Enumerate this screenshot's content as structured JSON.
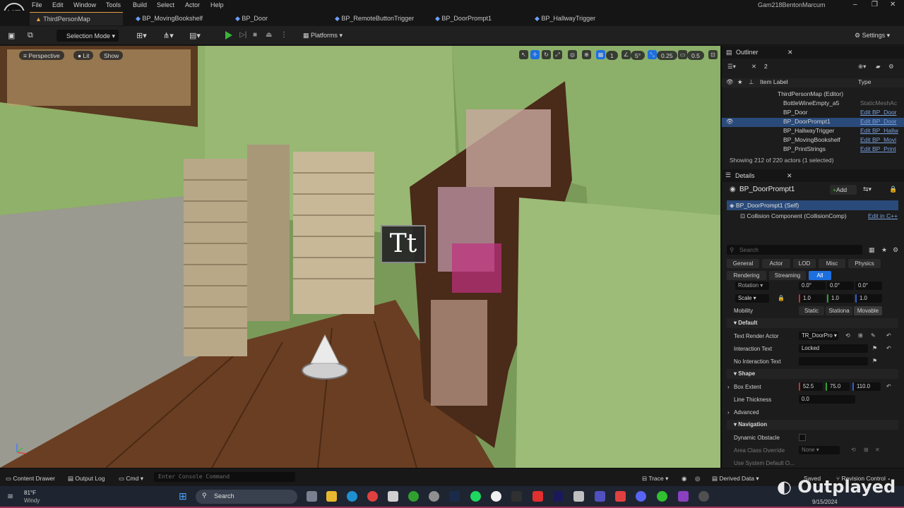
{
  "menubar": {
    "items": [
      "File",
      "Edit",
      "Window",
      "Tools",
      "Build",
      "Select",
      "Actor",
      "Help"
    ],
    "user": "Gam218BentonMarcum",
    "logo": "UE"
  },
  "tabs": [
    "ThirdPersonMap",
    "BP_MovingBookshelf",
    "BP_Door",
    "BP_RemoteButtonTrigger",
    "BP_DoorPrompt1",
    "BP_HallwayTrigger"
  ],
  "toolbar": {
    "selection_mode": "Selection Mode",
    "platforms": "Platforms",
    "settings": "Settings"
  },
  "viewport": {
    "perspective": "Perspective",
    "lit": "Lit",
    "show": "Show",
    "grid_size": "1",
    "angle": "5°",
    "scale_snap": "0.25",
    "camera_speed": "0.5",
    "text_render_glyph": "Tt"
  },
  "outliner": {
    "title": "Outliner",
    "search_value": "2",
    "col_label": "Item Label",
    "col_type": "Type",
    "items": [
      {
        "label": "ThirdPersonMap (Editor)",
        "type": ""
      },
      {
        "label": "BottleWineEmpty_a5",
        "type": "StaticMeshAc"
      },
      {
        "label": "BP_Door",
        "type": "Edit BP_Door"
      },
      {
        "label": "BP_DoorPrompt1",
        "type": "Edit BP_Door"
      },
      {
        "label": "BP_HallwayTrigger",
        "type": "Edit BP_Hallw"
      },
      {
        "label": "BP_MovingBookshelf",
        "type": "Edit BP_Movi"
      },
      {
        "label": "BP_PrintStrings",
        "type": "Edit BP_Print"
      }
    ],
    "status": "Showing 212 of 220 actors (1 selected)"
  },
  "details": {
    "title": "Details",
    "actor_name": "BP_DoorPrompt1",
    "add_label": "Add",
    "self_label": "BP_DoorPrompt1 (Self)",
    "component_label": "Collision Component (CollisionComp)",
    "edit_cpp": "Edit in C++",
    "search_placeholder": "Search",
    "categories": [
      "General",
      "Actor",
      "LOD",
      "Misc",
      "Physics",
      "Rendering",
      "Streaming",
      "All"
    ],
    "rotation_label": "Rotation",
    "rotation_values": [
      "0.0°",
      "0.0°",
      "0.0°"
    ],
    "scale_label": "Scale",
    "scale_values": [
      "1.0",
      "1.0",
      "1.0"
    ],
    "mobility_label": "Mobility",
    "mobility_options": [
      "Static",
      "Stationa",
      "Movable"
    ],
    "section_default": "Default",
    "text_render_actor_label": "Text Render Actor",
    "text_render_actor_value": "TR_DoorPro",
    "interaction_text_label": "Interaction Text",
    "interaction_text_value": "Locked",
    "no_interaction_text_label": "No Interaction Text",
    "no_interaction_text_value": "",
    "section_shape": "Shape",
    "box_extent_label": "Box Extent",
    "box_extent_values": [
      "52.5",
      "75.0",
      "110.0"
    ],
    "line_thickness_label": "Line Thickness",
    "line_thickness_value": "0.0",
    "advanced_label": "Advanced",
    "section_navigation": "Navigation",
    "dynamic_obstacle_label": "Dynamic Obstacle",
    "area_class_label": "Area Class Override",
    "area_class_value": "None",
    "use_system_default_label": "Use System Default O..."
  },
  "bottombar": {
    "content_drawer": "Content Drawer",
    "output_log": "Output Log",
    "cmd": "Cmd",
    "console_placeholder": "Enter Console Command",
    "trace": "Trace",
    "derived_data": "Derived Data",
    "saved": "Saved",
    "revision_control": "Revision Control"
  },
  "taskbar": {
    "temp": "81°F",
    "weather": "Windy",
    "search": "Search",
    "date": "9/15/2024"
  },
  "watermark": "Outplayed",
  "colors": {
    "accent": "#1d6fe0",
    "play": "#38b638",
    "selected_row": "#2a4a7a"
  }
}
